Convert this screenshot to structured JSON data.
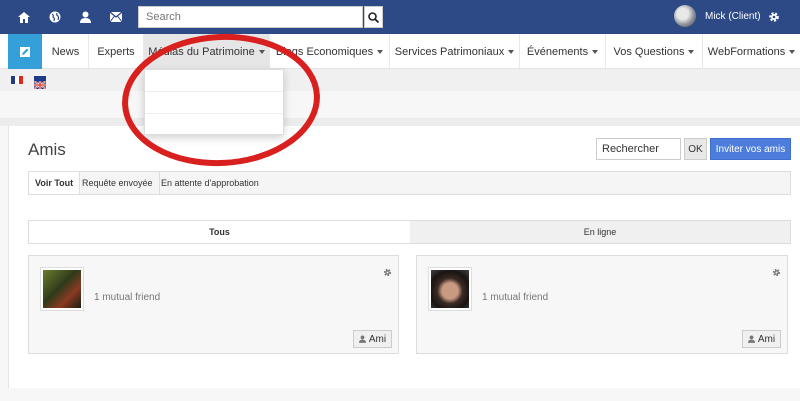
{
  "topbar": {
    "search_placeholder": "Search",
    "user_name": "Mick (Client)",
    "icons": [
      "home-icon",
      "globe-icon",
      "user-icon",
      "envelope-icon",
      "search-icon",
      "gear-icon"
    ]
  },
  "nav": {
    "items": [
      {
        "label": "News"
      },
      {
        "label": "Experts"
      },
      {
        "label": "Médias du Patrimoine"
      },
      {
        "label": "Blogs Economiques"
      },
      {
        "label": "Services Patrimoniaux"
      },
      {
        "label": "Événements"
      },
      {
        "label": "Vos Questions"
      },
      {
        "label": "WebFormations"
      }
    ]
  },
  "languages": [
    "fr-flag-icon",
    "uk-flag-icon"
  ],
  "page": {
    "title": "Amis",
    "search_value": "Rechercher",
    "ok_label": "OK",
    "invite_label": "Inviter vos amis"
  },
  "filters": [
    "Voir Tout",
    "Requête envoyée",
    "En attente d'approbation"
  ],
  "tabs": [
    "Tous",
    "En ligne"
  ],
  "friends": [
    {
      "mutual": "1 mutual friend",
      "button": "Ami"
    },
    {
      "mutual": "1 mutual friend",
      "button": "Ami"
    }
  ],
  "colors": {
    "topbar": "#2d4a86",
    "brand": "#35a0d8",
    "invite_button": "#4d7ddc",
    "annotation": "#d8201f"
  }
}
